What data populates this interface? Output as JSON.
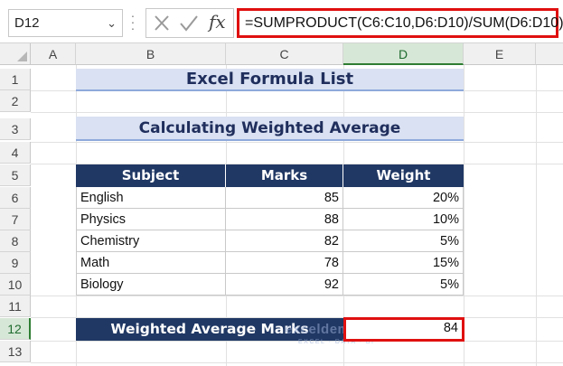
{
  "formula_bar": {
    "name_box": "D12",
    "cancel_icon": "cancel-x-icon",
    "enter_icon": "check-icon",
    "fx_label": "fx",
    "formula": "=SUMPRODUCT(C6:C10,D6:D10)/SUM(D6:D10)"
  },
  "columns": [
    "A",
    "B",
    "C",
    "D",
    "E"
  ],
  "rows": [
    "1",
    "2",
    "3",
    "4",
    "5",
    "6",
    "7",
    "8",
    "9",
    "10",
    "11",
    "12",
    "13"
  ],
  "sheet": {
    "title": "Excel Formula List",
    "subtitle": "Calculating Weighted Average",
    "table_headers": [
      "Subject",
      "Marks",
      "Weight"
    ],
    "table_rows": [
      {
        "subject": "English",
        "marks": "85",
        "weight": "20%"
      },
      {
        "subject": "Physics",
        "marks": "88",
        "weight": "10%"
      },
      {
        "subject": "Chemistry",
        "marks": "82",
        "weight": "5%"
      },
      {
        "subject": "Math",
        "marks": "78",
        "weight": "15%"
      },
      {
        "subject": "Biology",
        "marks": "92",
        "weight": "5%"
      }
    ],
    "weighted_label": "Weighted Average Marks",
    "weighted_value": "84"
  },
  "watermark": {
    "main": "exceldemy",
    "sub": "EXCEL · DATA · BI"
  },
  "colors": {
    "header_fill": "#203864",
    "title_fill": "#d9e1f2",
    "highlight_border": "#e01010",
    "selected_header": "#d7e7d7"
  }
}
